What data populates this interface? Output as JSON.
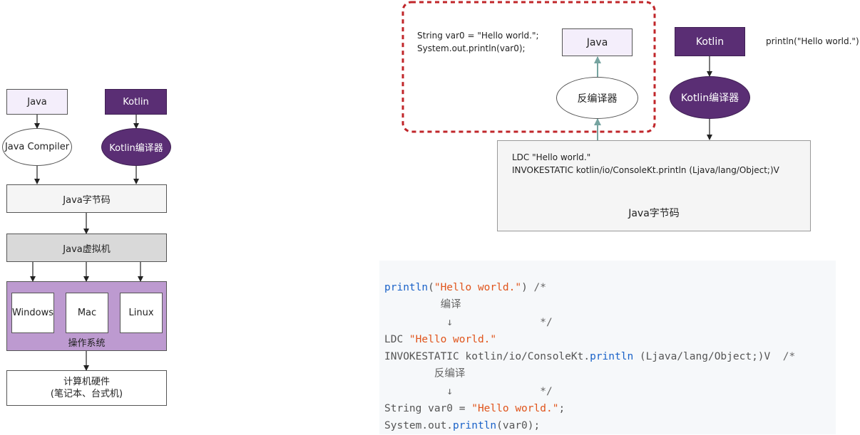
{
  "left_diagram": {
    "java": "Java",
    "kotlin": "Kotlin",
    "java_compiler": "Java Compiler",
    "kotlin_compiler": "Kotlin编译器",
    "bytecode": "Java字节码",
    "jvm": "Java虚拟机",
    "os_items": [
      "Windows",
      "Mac",
      "Linux"
    ],
    "os_label": "操作系统",
    "hardware_line1": "计算机硬件",
    "hardware_line2": "(笔记本、台式机)"
  },
  "right_diagram": {
    "decompiled_line1": "String var0 = \"Hello world.\";",
    "decompiled_line2": "System.out.println(var0);",
    "java": "Java",
    "decompiler": "反编译器",
    "kotlin": "Kotlin",
    "kotlin_compiler": "Kotlin编译器",
    "kotlin_source": "println(\"Hello world.\")",
    "bytecode_line1": "LDC \"Hello world.\"",
    "bytecode_line2": "INVOKESTATIC kotlin/io/ConsoleKt.println (Ljava/lang/Object;)V",
    "bytecode_label": "Java字节码"
  },
  "code": {
    "l1_fn": "println",
    "l1_open": "(",
    "l1_str": "\"Hello world.\"",
    "l1_close": ")",
    "l1_comment": " /*",
    "l2": "         编译",
    "l3": "          ↓              */",
    "l4_a": "LDC ",
    "l4_str": "\"Hello world.\"",
    "l5_a": "INVOKESTATIC kotlin/io/ConsoleKt.",
    "l5_fn": "println",
    "l5_b": " (Ljava/lang/Object;)V  ",
    "l5_comment": "/*",
    "l6": "        反编译",
    "l7": "          ↓              */",
    "l8_a": "String var0 = ",
    "l8_str": "\"Hello world.\"",
    "l8_b": ";",
    "l9_a": "System.out.",
    "l9_fn": "println",
    "l9_b": "(var0);"
  },
  "colors": {
    "java_fill": "#f4eefb",
    "kotlin_fill": "#5a2e74",
    "os_panel": "#bd9ad0",
    "jvm_fill": "#d9d9d9",
    "dashed_border": "#c0262a",
    "arrow_teal": "#76a4a0",
    "code_keyword": "#1a62c8",
    "code_string": "#e0541b"
  }
}
